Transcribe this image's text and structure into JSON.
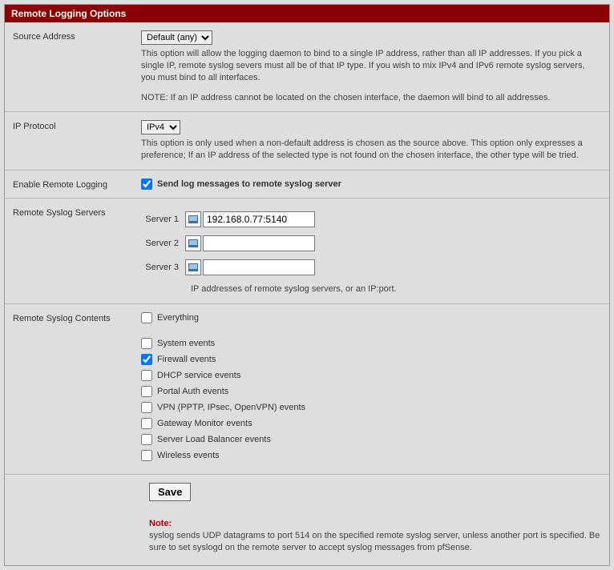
{
  "panel": {
    "title": "Remote Logging Options"
  },
  "source_address": {
    "label": "Source Address",
    "selected": "Default (any)",
    "desc1": "This option will allow the logging daemon to bind to a single IP address, rather than all IP addresses. If you pick a single IP, remote syslog severs must all be of that IP type. If you wish to mix IPv4 and IPv6 remote syslog servers, you must bind to all interfaces.",
    "desc2": "NOTE: If an IP address cannot be located on the chosen interface, the daemon will bind to all addresses."
  },
  "ip_protocol": {
    "label": "IP Protocol",
    "selected": "IPv4",
    "desc": "This option is only used when a non-default address is chosen as the source above. This option only expresses a preference; If an IP address of the selected type is not found on the chosen interface, the other type will be tried."
  },
  "enable_remote": {
    "label": "Enable Remote Logging",
    "checked": true,
    "text": "Send log messages to remote syslog server"
  },
  "servers": {
    "label": "Remote Syslog Servers",
    "rows": [
      {
        "label": "Server 1",
        "value": "192.168.0.77:5140"
      },
      {
        "label": "Server 2",
        "value": ""
      },
      {
        "label": "Server 3",
        "value": ""
      }
    ],
    "hint": "IP addresses of remote syslog servers, or an IP:port."
  },
  "contents": {
    "label": "Remote Syslog Contents",
    "items": [
      {
        "label": "Everything",
        "checked": false
      },
      {
        "label": "System events",
        "checked": false
      },
      {
        "label": "Firewall events",
        "checked": true
      },
      {
        "label": "DHCP service events",
        "checked": false
      },
      {
        "label": "Portal Auth events",
        "checked": false
      },
      {
        "label": "VPN (PPTP, IPsec, OpenVPN) events",
        "checked": false
      },
      {
        "label": "Gateway Monitor events",
        "checked": false
      },
      {
        "label": "Server Load Balancer events",
        "checked": false
      },
      {
        "label": "Wireless events",
        "checked": false
      }
    ]
  },
  "save": {
    "label": "Save"
  },
  "note": {
    "title": "Note:",
    "body": "syslog sends UDP datagrams to port 514 on the specified remote syslog server, unless another port is specified. Be sure to set syslogd on the remote server to accept syslog messages from pfSense."
  }
}
